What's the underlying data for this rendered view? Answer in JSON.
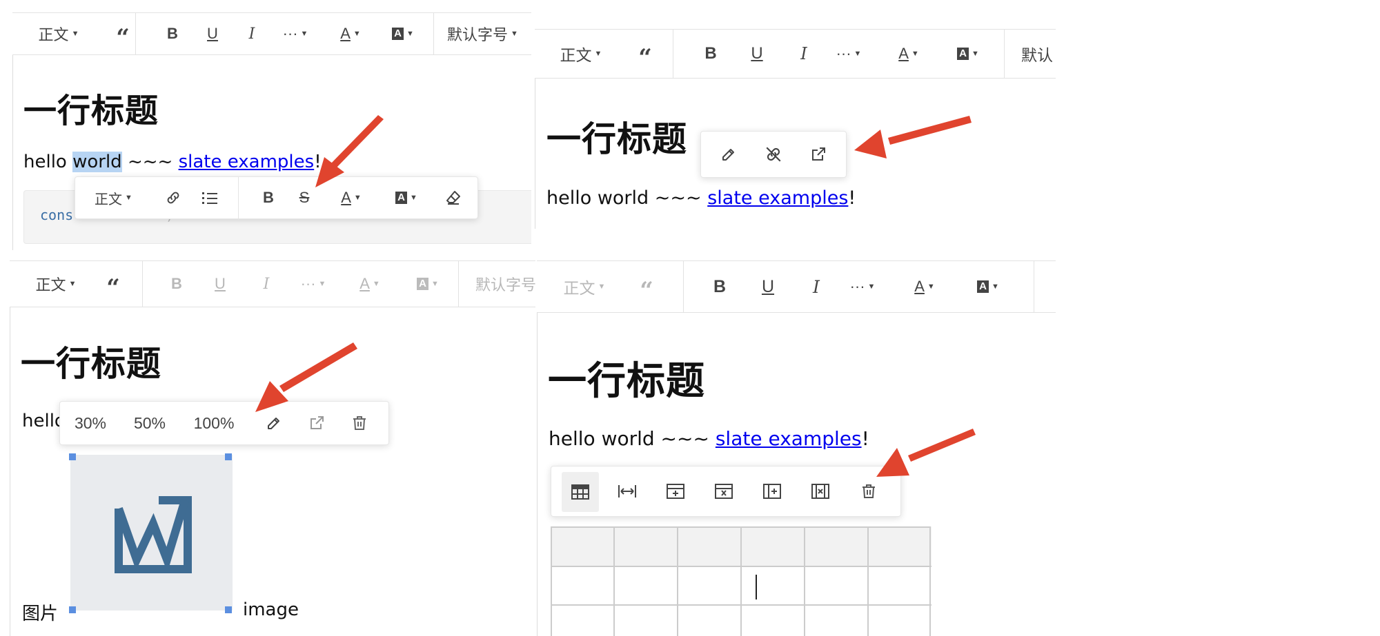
{
  "toolbar": {
    "paragraph_label": "正文",
    "font_size_label": "默认字号",
    "font_size_label_cut": "默认"
  },
  "content": {
    "heading": "一行标题",
    "hello_before": "hello ",
    "selected_word": "world",
    "hello_after": " ~~~ ",
    "link_text": "slate examples",
    "bang": "!",
    "hello_full": "hello world ~~~ ",
    "hello_cut": "hello",
    "code_left": "cons",
    "code_right": ")",
    "image_caption_left": "图片",
    "image_caption_right": "image"
  },
  "hover_toolbar": {
    "paragraph_label": "正文"
  },
  "image_menu": {
    "options": [
      "30%",
      "50%",
      "100%"
    ]
  },
  "colors": {
    "arrow": "#e0442e",
    "link": "#0000ee",
    "selection": "#b7d4f3",
    "image_bg": "#e9ebee",
    "image_logo": "#3f6c93",
    "handle": "#5b8fe0"
  },
  "icons": [
    "quote-icon",
    "bold-icon",
    "underline-icon",
    "italic-icon",
    "more-icon",
    "font-color-icon",
    "bg-color-icon",
    "link-icon",
    "bulleted-list-icon",
    "strikethrough-icon",
    "eraser-icon",
    "edit-icon",
    "unlink-icon",
    "open-link-icon",
    "delete-icon",
    "table-header-icon",
    "full-width-icon",
    "insert-row-icon",
    "delete-row-icon",
    "insert-col-icon",
    "delete-col-icon"
  ]
}
